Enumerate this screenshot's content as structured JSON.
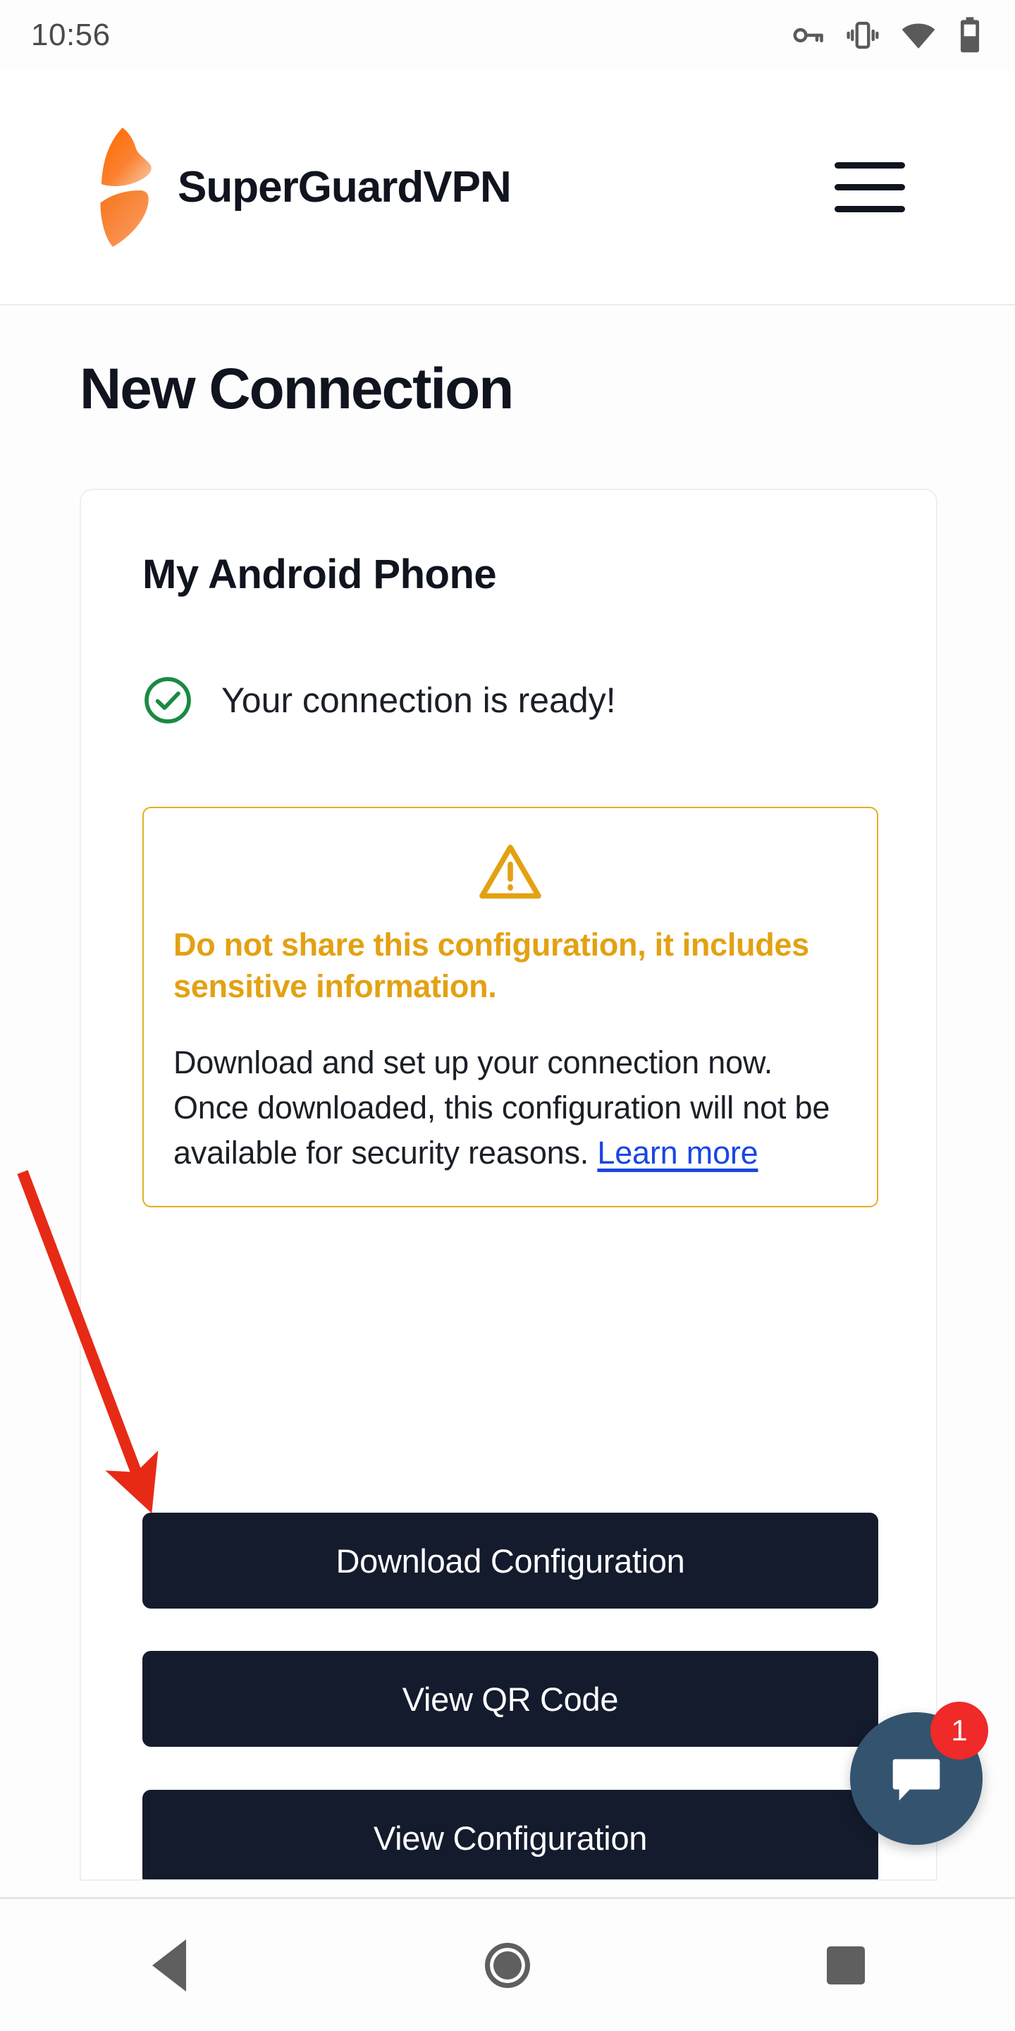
{
  "status_bar": {
    "clock": "10:56",
    "icons": [
      "vpn-key-icon",
      "vibrate-icon",
      "wifi-icon",
      "battery-icon"
    ]
  },
  "header": {
    "brand_name": "SuperGuardVPN",
    "logo_icon": "fox-logo-icon",
    "menu_icon": "hamburger-menu-icon",
    "brand_color": "#ff7b2c"
  },
  "page": {
    "title": "New Connection"
  },
  "card": {
    "title": "My Android Phone",
    "ready_icon": "check-circle-icon",
    "ready_text": "Your connection is ready!",
    "ready_color": "#1a8a42",
    "warning": {
      "icon": "warning-triangle-icon",
      "accent_color": "#e3a113",
      "border_color": "#e3ae22",
      "headline": "Do not share this configuration, it includes sensitive information.",
      "body_before_link": "Download and set up your connection now. Once downloaded, this configuration will not be available for security reasons. ",
      "link_label": "Learn more",
      "link_color": "#1a46e5"
    },
    "buttons": [
      {
        "label": "Download Configuration",
        "name": "download-configuration-button"
      },
      {
        "label": "View QR Code",
        "name": "view-qr-code-button"
      },
      {
        "label": "View Configuration",
        "name": "view-configuration-button"
      }
    ],
    "button_color": "#141b2d"
  },
  "chat_widget": {
    "icon": "chat-bubble-icon",
    "badge_count": "1",
    "fab_color": "#34536e",
    "badge_color": "#f02929"
  },
  "annotation": {
    "arrow_color": "#e62a15",
    "points_to": "download-configuration-button"
  },
  "nav_bar": {
    "back_icon": "back-triangle-icon",
    "home_icon": "home-circle-icon",
    "recents_icon": "recents-square-icon"
  }
}
